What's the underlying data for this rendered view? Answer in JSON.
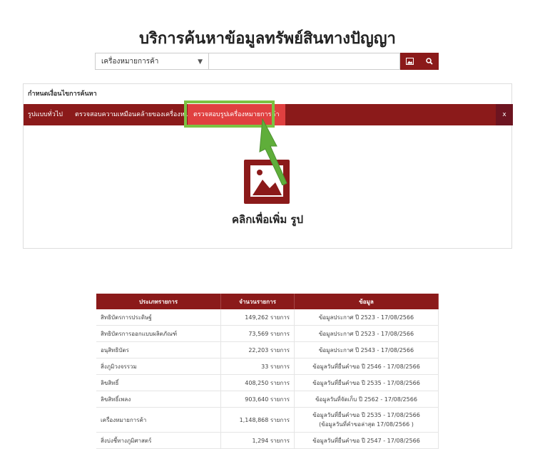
{
  "page": {
    "title": "บริการค้นหาข้อมูลทรัพย์สินทางปัญญา"
  },
  "search": {
    "selected_type": "เครื่องหมายการค้า",
    "input_value": "",
    "image_icon": "image-icon",
    "search_icon": "search-icon"
  },
  "panel": {
    "heading": "กำหนดเงื่อนไขการค้นหา",
    "tabs": [
      {
        "label": "รูปแบบทั่วไป"
      },
      {
        "label": "ตรวจสอบความเหมือนคล้ายของเครื่องหมาย"
      },
      {
        "label": "ตรวจสอบรูปเครื่องหมายการค้า"
      }
    ],
    "close_label": "x",
    "upload_label": "คลิกเพื่อเพิ่ม รูป"
  },
  "colors": {
    "brand": "#8b1a1a",
    "active_tab": "#e04040",
    "highlight": "#7cc242"
  },
  "table": {
    "headers": [
      "ประเภทรายการ",
      "จำนวนรายการ",
      "ข้อมูล"
    ],
    "rows": [
      {
        "type": "สิทธิบัตรการประดิษฐ์",
        "count": "149,262 รายการ",
        "info": "ข้อมูลประกาศ ปี 2523 - 17/08/2566",
        "info2": ""
      },
      {
        "type": "สิทธิบัตรการออกแบบผลิตภัณฑ์",
        "count": "73,569 รายการ",
        "info": "ข้อมูลประกาศ ปี 2523 - 17/08/2566",
        "info2": ""
      },
      {
        "type": "อนุสิทธิบัตร",
        "count": "22,203 รายการ",
        "info": "ข้อมูลประกาศ ปี 2543 - 17/08/2566",
        "info2": ""
      },
      {
        "type": "สิ่งภูมิวงจรรวม",
        "count": "33 รายการ",
        "info": "ข้อมูลวันที่ยื่นคำขอ ปี 2546 - 17/08/2566",
        "info2": ""
      },
      {
        "type": "ลิขสิทธิ์",
        "count": "408,250 รายการ",
        "info": "ข้อมูลวันที่ยื่นคำขอ ปี 2535 - 17/08/2566",
        "info2": ""
      },
      {
        "type": "ลิขสิทธิ์เพลง",
        "count": "903,640 รายการ",
        "info": "ข้อมูลวันที่จัดเก็บ ปี 2562 - 17/08/2566",
        "info2": ""
      },
      {
        "type": "เครื่องหมายการค้า",
        "count": "1,148,868 รายการ",
        "info": "ข้อมูลวันที่ยื่นคำขอ ปี 2535 - 17/08/2566",
        "info2": "(ข้อมูลวันที่คำขอล่าสุด 17/08/2566 )"
      },
      {
        "type": "สิ่งบ่งชี้ทางภูมิศาสตร์",
        "count": "1,294 รายการ",
        "info": "ข้อมูลวันที่ยื่นคำขอ ปี 2547 - 17/08/2566",
        "info2": ""
      }
    ]
  }
}
